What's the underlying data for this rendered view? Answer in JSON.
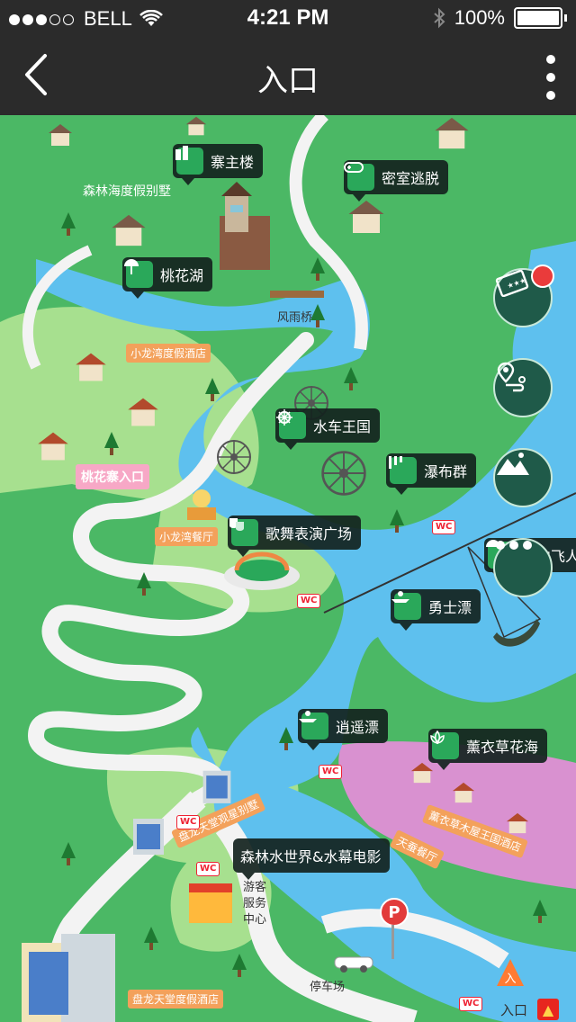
{
  "status_bar": {
    "carrier": "BELL",
    "time": "4:21 PM",
    "battery": "100%"
  },
  "nav": {
    "title": "入口"
  },
  "map": {
    "poi_markers": [
      {
        "id": "zhaizhulou",
        "label": "寨主楼",
        "icon": "building-icon"
      },
      {
        "id": "escape",
        "label": "密室逃脱",
        "icon": "gamepad-icon"
      },
      {
        "id": "taohuahu",
        "label": "桃花湖",
        "icon": "beach-umbrella-icon"
      },
      {
        "id": "waterwheel",
        "label": "水车王国",
        "icon": "ship-wheel-icon"
      },
      {
        "id": "waterfall",
        "label": "瀑布群",
        "icon": "waterfall-icon"
      },
      {
        "id": "dance",
        "label": "歌舞表演广场",
        "icon": "theater-mask-icon"
      },
      {
        "id": "sky",
        "label": "空中飞人",
        "icon": "umbrella-icon"
      },
      {
        "id": "brave",
        "label": "勇士漂",
        "icon": "raft-icon"
      },
      {
        "id": "xiaoyao",
        "label": "逍遥漂",
        "icon": "raft-icon"
      },
      {
        "id": "lavender",
        "label": "薰衣草花海",
        "icon": "lotus-icon"
      },
      {
        "id": "waterworld",
        "label": "森林水世界&水幕电影",
        "icon": ""
      }
    ],
    "labels": {
      "forest_villa": "森林海度假别墅",
      "bridge": "风雨桥",
      "xiaolongwan_hotel": "小龙湾度假酒店",
      "taohuazhai_gate": "桃花寨入口",
      "xiaolongwan_restaurant": "小龙湾餐厅",
      "panlong_villa": "盘龙天堂观星别墅",
      "lavender_kingdom": "薰衣草木屋王国酒店",
      "tiancan_restaurant": "天蚕餐厅",
      "visitor_center": "游客服务中心",
      "parking": "停车场",
      "panlong_hotel": "盘龙天堂度假酒店",
      "entrance": "入口",
      "wc": "WC",
      "parking_sign": "P",
      "entrance_badge": "入"
    }
  },
  "fabs": [
    {
      "id": "ticket",
      "icon": "ticket-icon",
      "has_badge": true
    },
    {
      "id": "route",
      "icon": "route-icon",
      "has_badge": false
    },
    {
      "id": "scenery",
      "icon": "mountain-icon",
      "has_badge": false
    },
    {
      "id": "more",
      "icon": "more-dots-icon",
      "has_badge": false
    }
  ],
  "colors": {
    "bar": "#2b2b2b",
    "grass": "#4bb865",
    "water": "#5ec0ee",
    "poi_icon_bg": "#2aa85a",
    "fab_bg": "#1f5a49",
    "badge": "#ea3b3b",
    "lavender": "#d991d0",
    "orange_tag": "#f3a15b"
  }
}
